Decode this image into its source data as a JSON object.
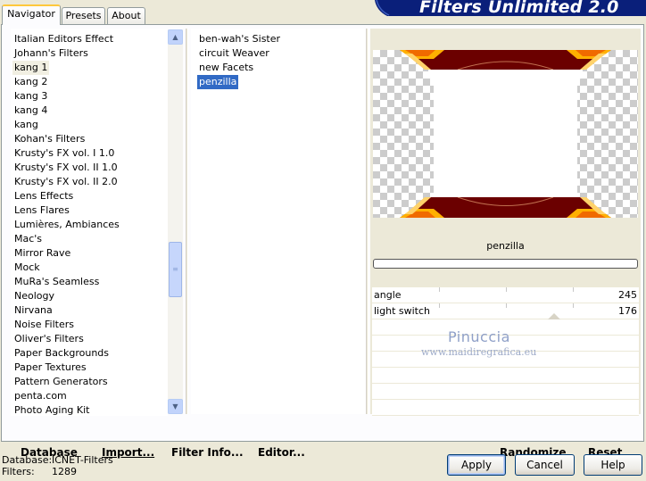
{
  "tabs": [
    "Navigator",
    "Presets",
    "About"
  ],
  "banner_title": "Filters Unlimited 2.0",
  "categories": [
    "Italian Editors Effect",
    "Johann's Filters",
    "kang 1",
    "kang 2",
    "kang 3",
    "kang 4",
    "kang",
    "Kohan's Filters",
    "Krusty's FX vol. I 1.0",
    "Krusty's FX vol. II 1.0",
    "Krusty's FX vol. II 2.0",
    "Lens Effects",
    "Lens Flares",
    "Lumières, Ambiances",
    "Mac's",
    "Mirror Rave",
    "Mock",
    "MuRa's Seamless",
    "Neology",
    "Nirvana",
    "Noise Filters",
    "Oliver's Filters",
    "Paper Backgrounds",
    "Paper Textures",
    "Pattern Generators",
    "penta.com",
    "Photo Aging Kit"
  ],
  "selected_category": "kang 1",
  "filters": [
    "ben-wah's Sister",
    "circuit Weaver",
    "new Facets",
    "penzilla"
  ],
  "selected_filter": "penzilla",
  "preview_filter_name": "penzilla",
  "params": [
    {
      "name": "angle",
      "value": "245"
    },
    {
      "name": "light switch",
      "value": "176"
    }
  ],
  "watermark": {
    "name": "Pinuccia",
    "site": "www.maidiregrafica.eu"
  },
  "actions": {
    "database": "Database",
    "import": "Import...",
    "filter_info": "Filter Info...",
    "editor": "Editor...",
    "randomize": "Randomize",
    "reset": "Reset"
  },
  "status": {
    "database_label": "Database:",
    "database_value": "ICNET-Filters",
    "filters_label": "Filters:",
    "filters_value": "1289"
  },
  "buttons": {
    "apply": "Apply",
    "cancel": "Cancel",
    "help": "Help"
  },
  "colors": {
    "selection": "#316AC5",
    "banner": "#0A1F7A",
    "dialog_bg": "#ECE9D8"
  }
}
